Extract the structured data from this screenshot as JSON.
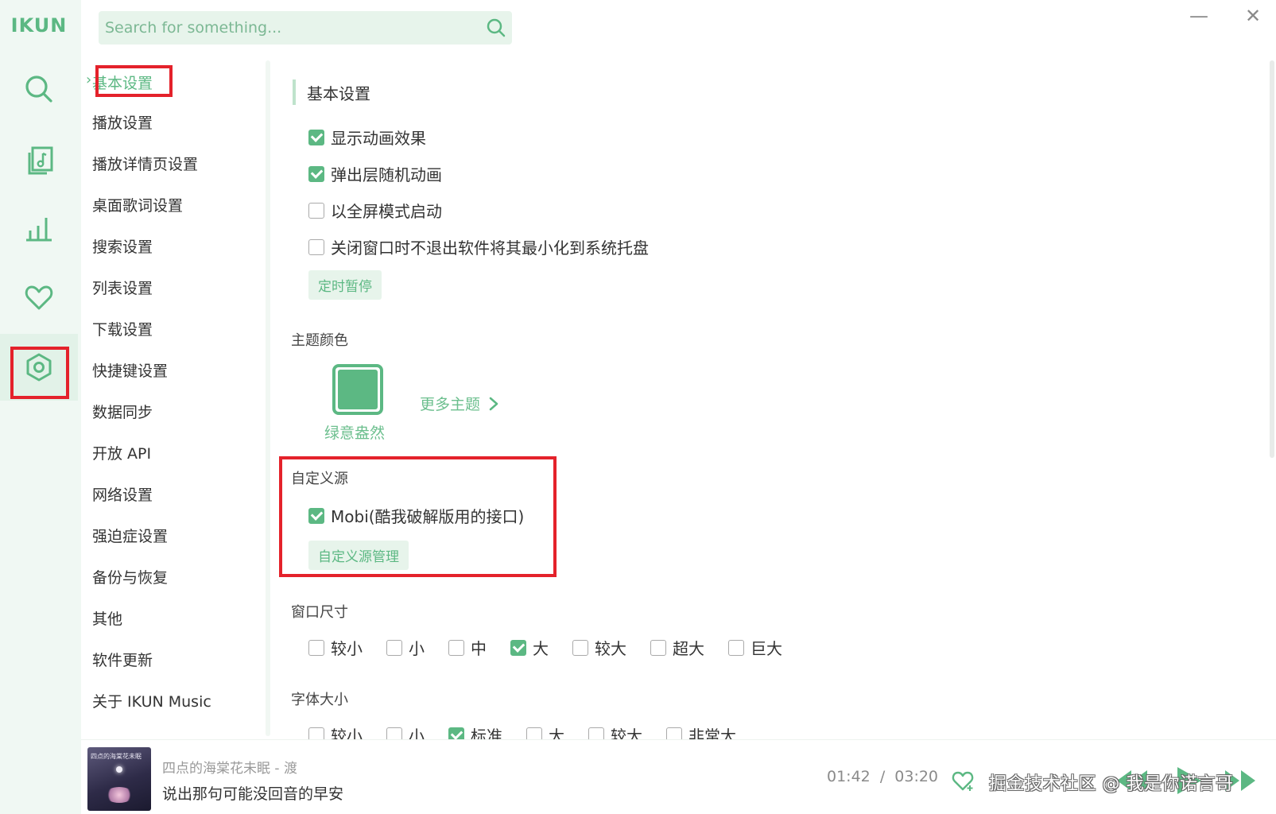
{
  "app": {
    "logo": "IKUN"
  },
  "search": {
    "placeholder": "Search for something..."
  },
  "rail": {
    "items": [
      {
        "icon": "search-icon",
        "active": false
      },
      {
        "icon": "music-library-icon",
        "active": false
      },
      {
        "icon": "chart-icon",
        "active": false
      },
      {
        "icon": "heart-icon",
        "active": false
      },
      {
        "icon": "settings-icon",
        "active": true
      }
    ]
  },
  "nav": {
    "items": [
      "基本设置",
      "播放设置",
      "播放详情页设置",
      "桌面歌词设置",
      "搜索设置",
      "列表设置",
      "下载设置",
      "快捷键设置",
      "数据同步",
      "开放 API",
      "网络设置",
      "强迫症设置",
      "备份与恢复",
      "其他",
      "软件更新",
      "关于 IKUN Music"
    ],
    "active_index": 0
  },
  "basic": {
    "title": "基本设置",
    "options": [
      {
        "label": "显示动画效果",
        "checked": true
      },
      {
        "label": "弹出层随机动画",
        "checked": true
      },
      {
        "label": "以全屏模式启动",
        "checked": false
      },
      {
        "label": "关闭窗口时不退出软件将其最小化到系统托盘",
        "checked": false
      }
    ],
    "timer_button": "定时暂停"
  },
  "theme": {
    "title": "主题颜色",
    "current_name": "绿意盎然",
    "current_color": "#5cb883",
    "more_label": "更多主题"
  },
  "custom_source": {
    "title": "自定义源",
    "option": {
      "label": "Mobi(酷我破解版用的接口)",
      "checked": true
    },
    "manage_button": "自定义源管理"
  },
  "window_size": {
    "title": "窗口尺寸",
    "options": [
      {
        "label": "较小",
        "checked": false
      },
      {
        "label": "小",
        "checked": false
      },
      {
        "label": "中",
        "checked": false
      },
      {
        "label": "大",
        "checked": true
      },
      {
        "label": "较大",
        "checked": false
      },
      {
        "label": "超大",
        "checked": false
      },
      {
        "label": "巨大",
        "checked": false
      }
    ]
  },
  "font_size": {
    "title": "字体大小",
    "options": [
      {
        "label": "较小",
        "checked": false
      },
      {
        "label": "小",
        "checked": false
      },
      {
        "label": "标准",
        "checked": true
      },
      {
        "label": "大",
        "checked": false
      },
      {
        "label": "较大",
        "checked": false
      },
      {
        "label": "非常大",
        "checked": false
      }
    ]
  },
  "player": {
    "cover_text": "四点的海棠花未眠",
    "song_title": "四点的海棠花未眠 - 渡",
    "lyric": "说出那句可能没回音的早安",
    "current_time": "01:42",
    "separator": "/",
    "total_time": "03:20"
  },
  "watermark": "掘金技术社区 @ 我是你诺言哥",
  "colors": {
    "accent": "#5cb883",
    "highlight_red": "#e4222b",
    "rail_bg": "#f0f8f3"
  }
}
